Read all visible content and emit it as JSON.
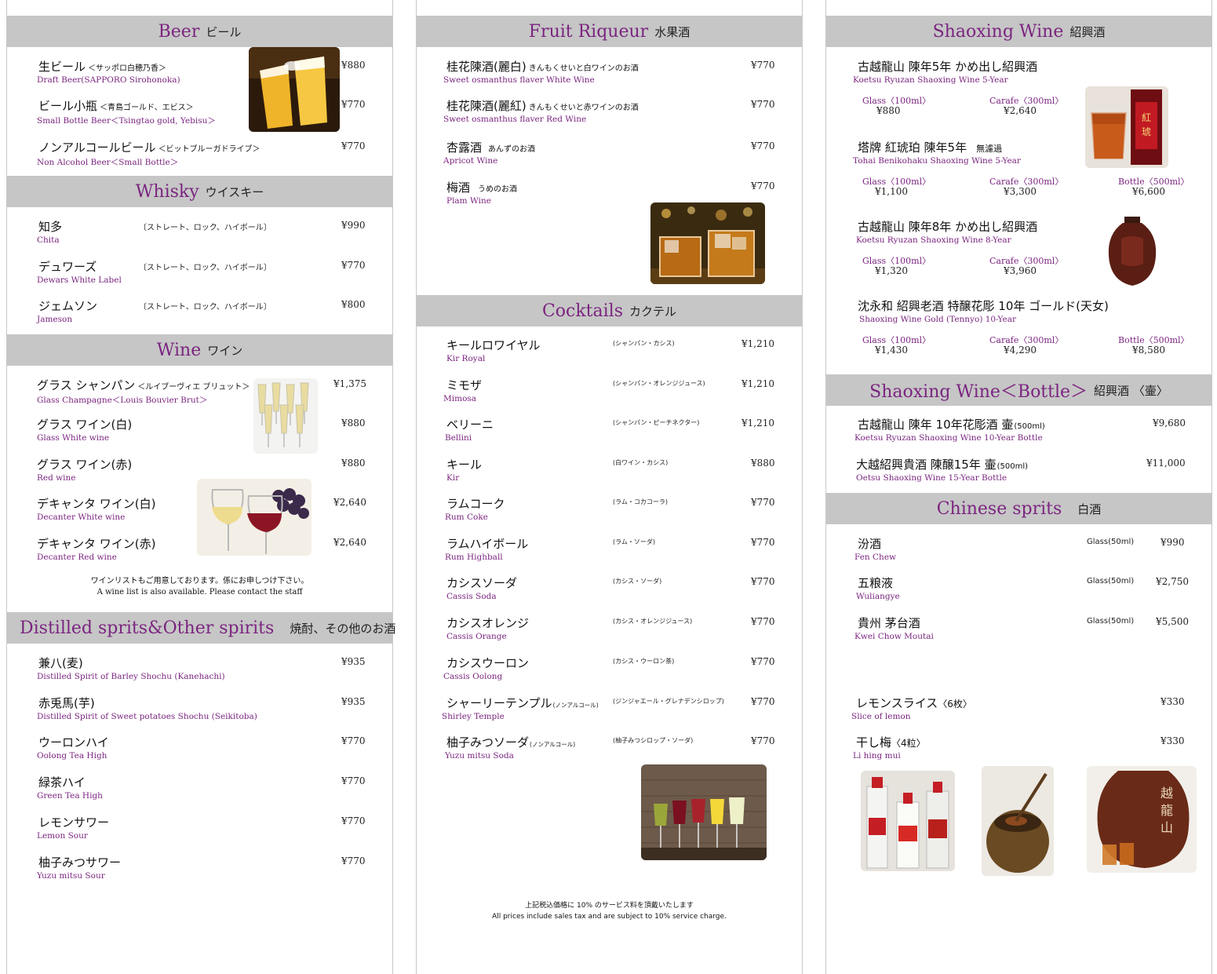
{
  "col1": {
    "beer": {
      "title_en": "Beer",
      "title_jp": "ビール",
      "items": [
        {
          "name": "生ビール",
          "detail": "＜サッポロ白穂乃香＞",
          "sub": "Draft Beer(SAPPORO Sirohonoka)",
          "price": "¥880"
        },
        {
          "name": "ビール小瓶",
          "detail": "＜青島ゴールド、エビス＞",
          "sub": "Small Bottle Beer＜Tsingtao gold, Yebisu＞",
          "price": "¥770"
        },
        {
          "name": "ノンアルコールビール",
          "detail": "＜ビットブルーガドライブ＞",
          "sub": "Non Alcohol Beer＜Small Bottle＞",
          "price": "¥770"
        }
      ]
    },
    "whisky": {
      "title_en": "Whisky",
      "title_jp": "ウイスキー",
      "items": [
        {
          "name": "知多",
          "desc": "〔ストレート、ロック、ハイボール〕",
          "sub": "Chita",
          "price": "¥990"
        },
        {
          "name": "デュワーズ",
          "desc": "〔ストレート、ロック、ハイボール〕",
          "sub": "Dewars White Label",
          "price": "¥770"
        },
        {
          "name": "ジェムソン",
          "desc": "〔ストレート、ロック、ハイボール〕",
          "sub": "Jameson",
          "price": "¥800"
        }
      ]
    },
    "wine": {
      "title_en": "Wine",
      "title_jp": "ワイン",
      "items": [
        {
          "name": "グラス シャンパン",
          "detail": "＜ルイブーヴィエ ブリュット＞",
          "sub": "Glass Champagne＜Louis Bouvier Brut＞",
          "price": "¥1,375"
        },
        {
          "name": "グラス ワイン(白)",
          "sub": "Glass White wine",
          "price": "¥880"
        },
        {
          "name": "グラス ワイン(赤)",
          "sub": "Red wine",
          "price": "¥880"
        },
        {
          "name": "デキャンタ ワイン(白)",
          "sub": "Decanter White wine",
          "price": "¥2,640"
        },
        {
          "name": "デキャンタ ワイン(赤)",
          "sub": "Decanter Red wine",
          "price": "¥2,640"
        }
      ],
      "note_jp": "ワインリストもご用意しております。係にお申しつけ下さい。",
      "note_en": "A wine list is also available. Please contact the staff"
    },
    "distilled": {
      "title_en": "Distilled sprits&Other spirits",
      "title_jp": "焼酎、その他のお酒",
      "items": [
        {
          "name": "兼八(麦)",
          "sub": "Distilled Spirit of Barley Shochu (Kanehachi)",
          "price": "¥935"
        },
        {
          "name": "赤兎馬(芋)",
          "sub": "Distilled Spirit of Sweet potatoes Shochu (Seikitoba)",
          "price": "¥935"
        },
        {
          "name": "ウーロンハイ",
          "sub": "Oolong Tea High",
          "price": "¥770"
        },
        {
          "name": "緑茶ハイ",
          "sub": "Green Tea High",
          "price": "¥770"
        },
        {
          "name": "レモンサワー",
          "sub": "Lemon Sour",
          "price": "¥770"
        },
        {
          "name": "柚子みつサワー",
          "sub": "Yuzu mitsu Sour",
          "price": "¥770"
        }
      ]
    }
  },
  "col2": {
    "fruit": {
      "title_en": "Fruit Riqueur",
      "title_jp": "水果酒",
      "items": [
        {
          "name": "桂花陳酒(麗白)",
          "detail": "きんもくせいと白ワインのお酒",
          "sub": "Sweet osmanthus flaver White Wine",
          "price": "¥770"
        },
        {
          "name": "桂花陳酒(麗紅)",
          "detail": "きんもくせいと赤ワインのお酒",
          "sub": "Sweet osmanthus flaver Red Wine",
          "price": "¥770"
        },
        {
          "name": "杏露酒",
          "detail": "あんずのお酒",
          "sub": "Apricot Wine",
          "price": "¥770"
        },
        {
          "name": "梅酒",
          "detail": "うめのお酒",
          "sub": "Plam Wine",
          "price": "¥770"
        }
      ]
    },
    "cocktails": {
      "title_en": "Cocktails",
      "title_jp": "カクテル",
      "items": [
        {
          "name": "キールロワイヤル",
          "desc": "(シャンパン・カシス)",
          "sub": "Kir Royal",
          "price": "¥1,210"
        },
        {
          "name": "ミモザ",
          "desc": "(シャンパン・オレンジジュース)",
          "sub": "Mimosa",
          "price": "¥1,210"
        },
        {
          "name": "ベリーニ",
          "desc": "(シャンパン・ピーチネクター)",
          "sub": "Bellini",
          "price": "¥1,210"
        },
        {
          "name": "キール",
          "desc": "(白ワイン・カシス)",
          "sub": "Kir",
          "price": "¥880"
        },
        {
          "name": "ラムコーク",
          "desc": "(ラム・コカコーラ)",
          "sub": "Rum Coke",
          "price": "¥770"
        },
        {
          "name": "ラムハイボール",
          "desc": "(ラム・ソーダ)",
          "sub": "Rum Highball",
          "price": "¥770"
        },
        {
          "name": "カシスソーダ",
          "desc": "(カシス・ソーダ)",
          "sub": "Cassis Soda",
          "price": "¥770"
        },
        {
          "name": "カシスオレンジ",
          "desc": "(カシス・オレンジジュース)",
          "sub": "Cassis Orange",
          "price": "¥770"
        },
        {
          "name": "カシスウーロン",
          "desc": "(カシス・ウーロン茶)",
          "sub": "Cassis Oolong",
          "price": "¥770"
        },
        {
          "name": "シャーリーテンプル",
          "detail": "(ノンアルコール)",
          "desc": "(ジンジャエール・グレナデンシロップ)",
          "sub": "Shirley Temple",
          "price": "¥770"
        },
        {
          "name": "柚子みつソーダ",
          "detail": "(ノンアルコール)",
          "desc": "(柚子みつシロップ・ソーダ)",
          "sub": "Yuzu mitsu Soda",
          "price": "¥770"
        }
      ]
    },
    "footer_jp": "上記税込価格に 10% のサービス料を頂戴いたします",
    "footer_en": "All prices include sales tax and are subject to 10% service charge."
  },
  "col3": {
    "shaoxing": {
      "title_en": "Shaoxing Wine",
      "title_jp": "紹興酒",
      "items": [
        {
          "name": "古越龍山 陳年5年 かめ出し紹興酒",
          "sub": "Koetsu Ryuzan Shaoxing Wine  5-Year",
          "sizes": [
            {
              "label": "Glass〈100ml〉",
              "price": "¥880"
            },
            {
              "label": "Carafe〈300ml〉",
              "price": "¥2,640"
            }
          ]
        },
        {
          "name": "塔牌 紅琥珀 陳年5年",
          "detail": "無濾過",
          "sub": "Tohai Benikohaku Shaoxing Wine 5-Year",
          "sizes": [
            {
              "label": "Glass〈100ml〉",
              "price": "¥1,100"
            },
            {
              "label": "Carafe〈300ml〉",
              "price": "¥3,300"
            },
            {
              "label": "Bottle〈500ml〉",
              "price": "¥6,600"
            }
          ]
        },
        {
          "name": "古越龍山 陳年8年 かめ出し紹興酒",
          "sub": "Koetsu Ryuzan Shaoxing Wine  8-Year",
          "sizes": [
            {
              "label": "Glass〈100ml〉",
              "price": "¥1,320"
            },
            {
              "label": "Carafe〈300ml〉",
              "price": "¥3,960"
            }
          ]
        },
        {
          "name": "沈永和 紹興老酒 特醸花彫 10年 ゴールド(天女)",
          "sub": "Shaoxing Wine Gold (Tennyo) 10-Year",
          "sizes": [
            {
              "label": "Glass〈100ml〉",
              "price": "¥1,430"
            },
            {
              "label": "Carafe〈300ml〉",
              "price": "¥4,290"
            },
            {
              "label": "Bottle〈500ml〉",
              "price": "¥8,580"
            }
          ]
        }
      ]
    },
    "bottle": {
      "title_en": "Shaoxing Wine＜Bottle＞",
      "title_jp": "紹興酒 〈壷〉",
      "items": [
        {
          "name": "古越龍山 陳年 10年花彫酒 壷",
          "detail": "(500ml)",
          "sub": "Koetsu Ryuzan Shaoxing Wine  10-Year Bottle",
          "price": "¥9,680"
        },
        {
          "name": "大越紹興貴酒 陳醸15年 壷",
          "detail": "(500ml)",
          "sub": "Oetsu Shaoxing Wine  15-Year Bottle",
          "price": "¥11,000"
        }
      ]
    },
    "chinese": {
      "title_en": "Chinese sprits",
      "title_jp": "白酒",
      "items": [
        {
          "name": "汾酒",
          "glass": "Glass(50ml)",
          "sub": "Fen Chew",
          "price": "¥990"
        },
        {
          "name": "五粮液",
          "glass": "Glass(50ml)",
          "sub": "Wuliangye",
          "price": "¥2,750"
        },
        {
          "name": "貴州 茅台酒",
          "glass": "Glass(50ml)",
          "sub": "Kwei Chow Moutai",
          "price": "¥5,500"
        }
      ],
      "extras": [
        {
          "name": "レモンスライス",
          "detail": "〈6枚〉",
          "sub": "Slice of lemon",
          "price": "¥330"
        },
        {
          "name": "干し梅",
          "detail": "〈4粒〉",
          "sub": "Li hing mui",
          "price": "¥330"
        }
      ]
    }
  }
}
